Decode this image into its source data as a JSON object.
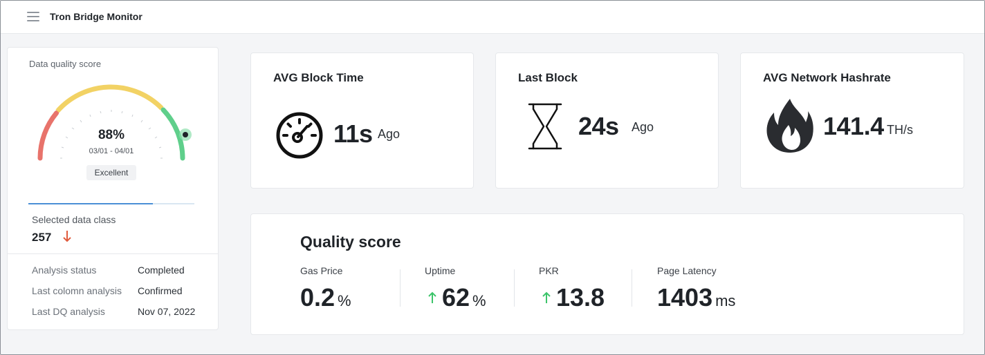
{
  "header": {
    "app_title": "Tron Bridge Monitor",
    "menu_icon": "hamburger-icon"
  },
  "data_quality": {
    "label": "Data quality score",
    "score": "88%",
    "score_fraction": 0.88,
    "date_range": "03/01 - 04/01",
    "badge": "Excellent",
    "progress_fraction": 0.75,
    "selected_label": "Selected data class",
    "selected_value": "257",
    "selected_trend": "down",
    "colors": {
      "red": "#e8736b",
      "yellow": "#f2d264",
      "green": "#5fcf8b",
      "trend_down": "#e05a3c"
    },
    "info": [
      {
        "key": "Analysis status",
        "value": "Completed"
      },
      {
        "key": "Last colomn analysis",
        "value": "Confirmed"
      },
      {
        "key": "Last DQ analysis",
        "value": "Nov 07, 2022"
      }
    ]
  },
  "cards": {
    "block_time": {
      "title": "AVG Block Time",
      "value": "11s",
      "unit": "Ago",
      "icon": "speedometer-icon"
    },
    "last_block": {
      "title": "Last Block",
      "value": "24s",
      "unit": "Ago",
      "icon": "hourglass-icon"
    },
    "hashrate": {
      "title": "AVG Network Hashrate",
      "value": "141.4",
      "unit": "TH/s",
      "icon": "flame-icon"
    }
  },
  "quality_score": {
    "title": "Quality score",
    "metrics": [
      {
        "label": "Gas Price",
        "value": "0.2",
        "unit": "%",
        "trend": "none"
      },
      {
        "label": "Uptime",
        "value": "62",
        "unit": "%",
        "trend": "up"
      },
      {
        "label": "PKR",
        "value": "13.8",
        "unit": "",
        "trend": "up"
      },
      {
        "label": "Page Latency",
        "value": "1403",
        "unit": "ms",
        "trend": "none"
      }
    ],
    "trend_up_color": "#3cc46a"
  }
}
